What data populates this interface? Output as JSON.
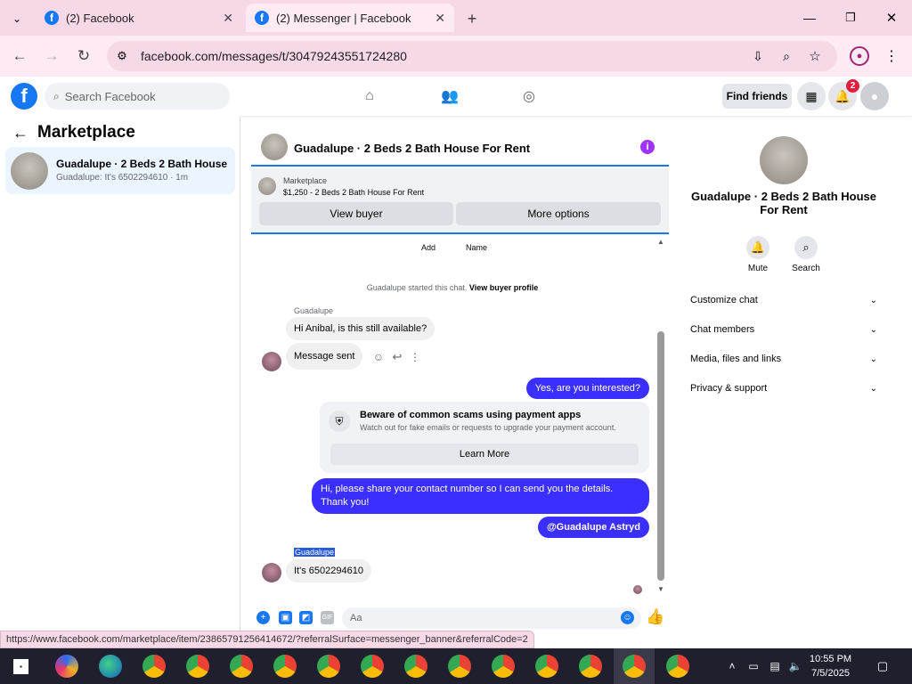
{
  "browser": {
    "tabs": [
      {
        "label": "(2) Facebook",
        "active": false
      },
      {
        "label": "(2) Messenger | Facebook",
        "active": true
      }
    ],
    "url": "facebook.com/messages/t/30479243551724280"
  },
  "fb_header": {
    "search_placeholder": "Search Facebook",
    "find_friends_label": "Find friends",
    "notification_count": "2"
  },
  "left": {
    "title": "Marketplace",
    "conversation": {
      "title": "Guadalupe · 2 Beds 2 Bath House ...",
      "subtitle": "Guadalupe: It's 6502294610 · 1m"
    }
  },
  "chat": {
    "title": "Guadalupe · 2 Beds 2 Bath House For Rent",
    "banner": {
      "label": "Marketplace",
      "listing": "$1,250 - 2 Beds 2 Bath House For Rent",
      "view_buyer": "View buyer",
      "more_options": "More options"
    },
    "partial_labels": {
      "add": "Add",
      "name": "Name"
    },
    "started_text": "Guadalupe started this chat.",
    "view_buyer_profile": "View buyer profile",
    "messages": {
      "sender1": "Guadalupe",
      "in1": "Hi Anibal, is this still available?",
      "in2": "Message sent",
      "out1": "Yes, are you interested?",
      "out2": "Hi, please share your contact number so I can send you the details. Thank you!",
      "out3": "@Guadalupe Astryd",
      "sender2": "Guadalupe",
      "in3": "It's 6502294610"
    },
    "scam": {
      "title": "Beware of common scams using payment apps",
      "subtitle": "Watch out for fake emails or requests to upgrade your payment account.",
      "button": "Learn More"
    },
    "composer_placeholder": "Aa"
  },
  "right": {
    "title": "Guadalupe · 2 Beds 2 Bath House For Rent",
    "mute_label": "Mute",
    "search_label": "Search",
    "menu": [
      "Customize chat",
      "Chat members",
      "Media, files and links",
      "Privacy & support"
    ]
  },
  "status_url": "https://www.facebook.com/marketplace/item/23865791256414672/?referralSurface=messenger_banner&referralCode=2",
  "taskbar": {
    "time": "10:55 PM",
    "date": "7/5/2025"
  },
  "colors": {
    "fb_blue": "#1877f2",
    "message_out": "#3a2fff",
    "tab_bar": "#f6d8e6"
  }
}
